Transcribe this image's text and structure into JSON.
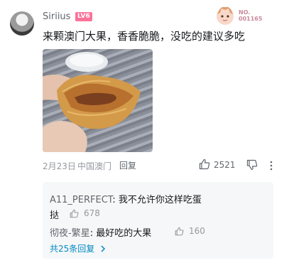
{
  "comment": {
    "username": "Siriius",
    "level": "LV6",
    "fan_badge_no_label": "NO.",
    "fan_badge_no": "001165",
    "text": "来颗澳门大果，香香脆脆，没吃的建议多吃",
    "date": "2月23日",
    "location": "中国澳门",
    "reply_label": "回复",
    "likes": "2521"
  },
  "sub_replies": [
    {
      "user": "A11_PERFECT",
      "text_line1": "我不允许你这样吃蛋",
      "text_line2": "挞",
      "likes": "678"
    },
    {
      "user": "彻夜-繁星",
      "text_line1": "最好吃的大果",
      "likes": "160"
    }
  ],
  "total_replies_label": "共25条回复",
  "colors": {
    "accent_pink": "#fb7299",
    "link_blue": "#008ac5",
    "muted": "#9499a0"
  },
  "icons": [
    "thumbs-up-icon",
    "thumbs-down-icon",
    "more-icon",
    "chevron-right-icon"
  ]
}
